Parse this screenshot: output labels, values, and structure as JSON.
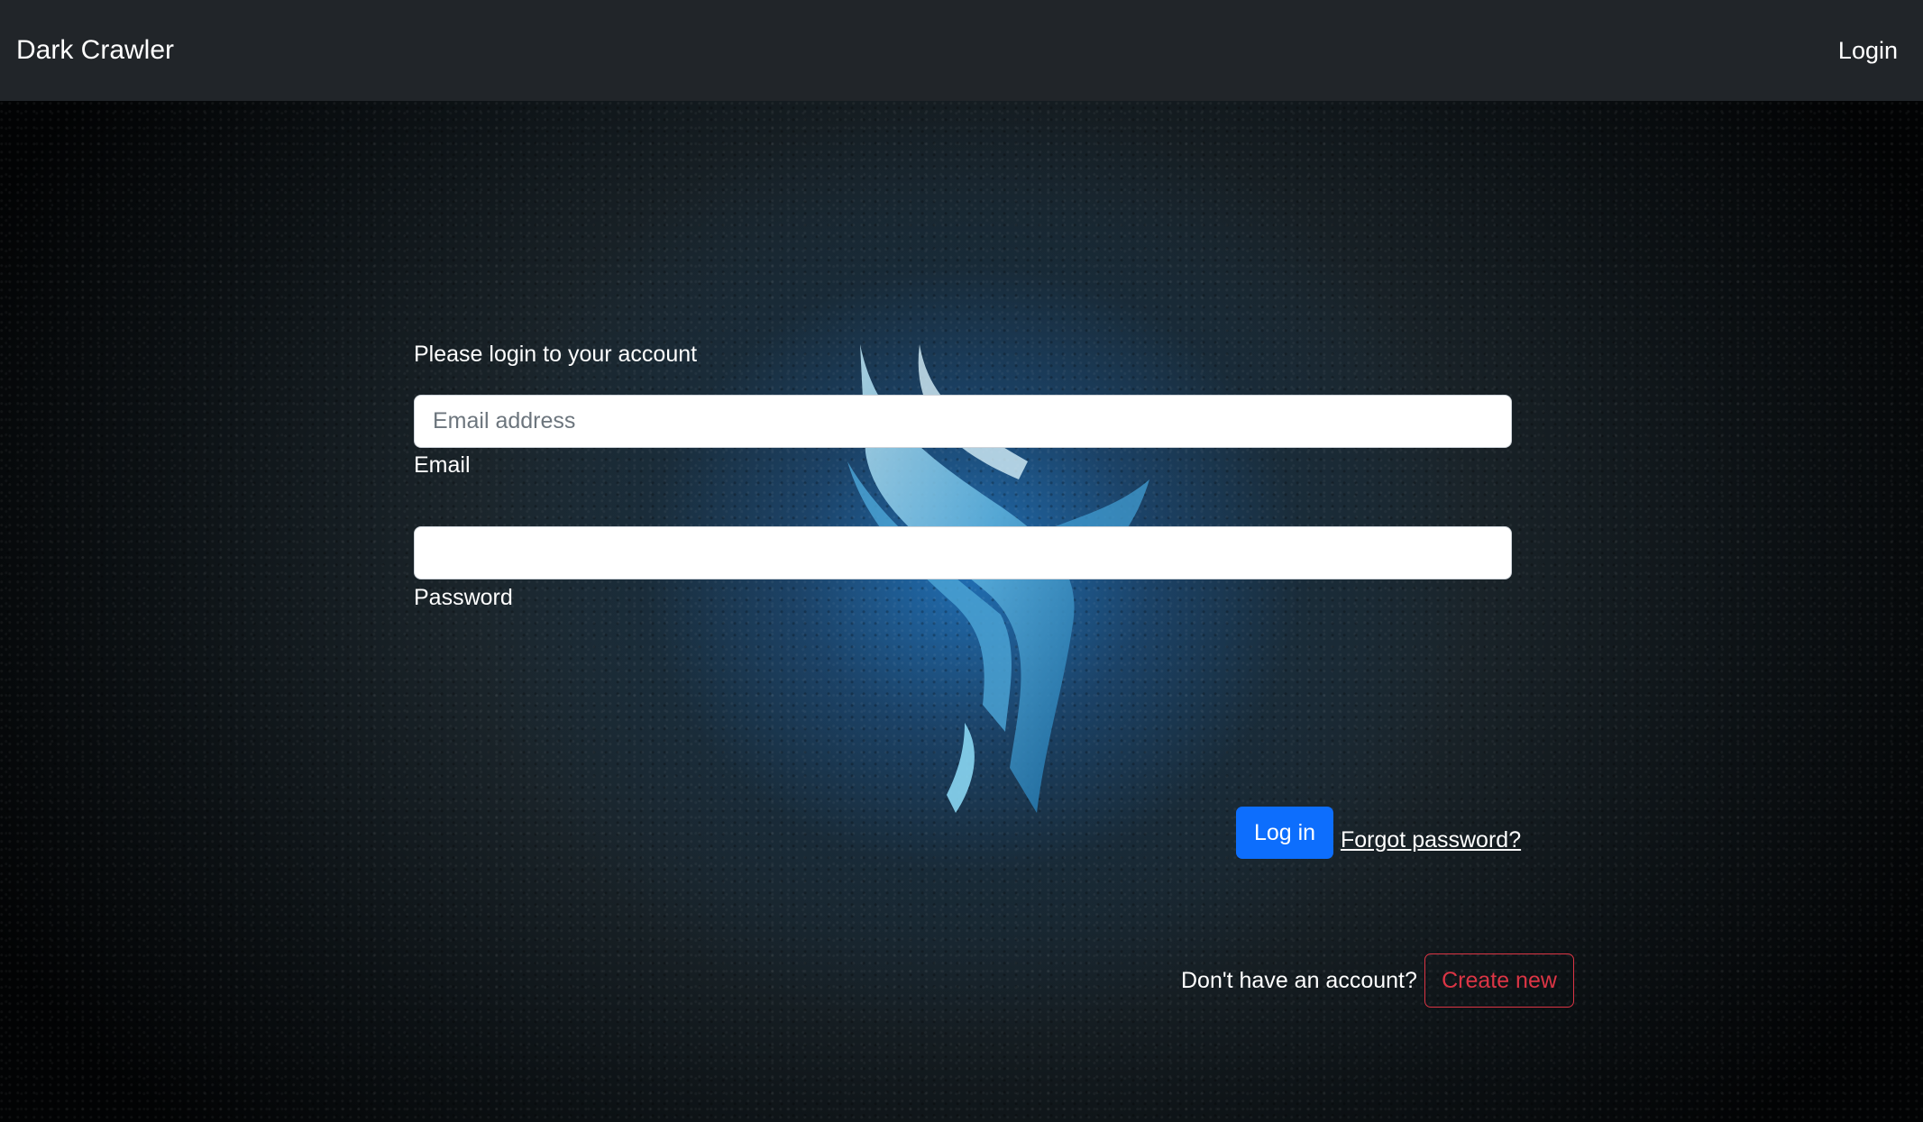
{
  "navbar": {
    "brand": "Dark Crawler",
    "login_link": "Login"
  },
  "login_form": {
    "prompt": "Please login to your account",
    "email": {
      "placeholder": "Email address",
      "value": "",
      "label": "Email"
    },
    "password": {
      "placeholder": "",
      "value": "",
      "label": "Password"
    },
    "login_button": "Log in",
    "forgot_link": "Forgot password?",
    "no_account_text": "Don't have an account?",
    "create_button": "Create new"
  },
  "colors": {
    "navbar_bg": "#212529",
    "primary": "#0d6efd",
    "danger": "#dc3545"
  },
  "icons": {
    "background_emblem": "blue-blade-emblem"
  }
}
